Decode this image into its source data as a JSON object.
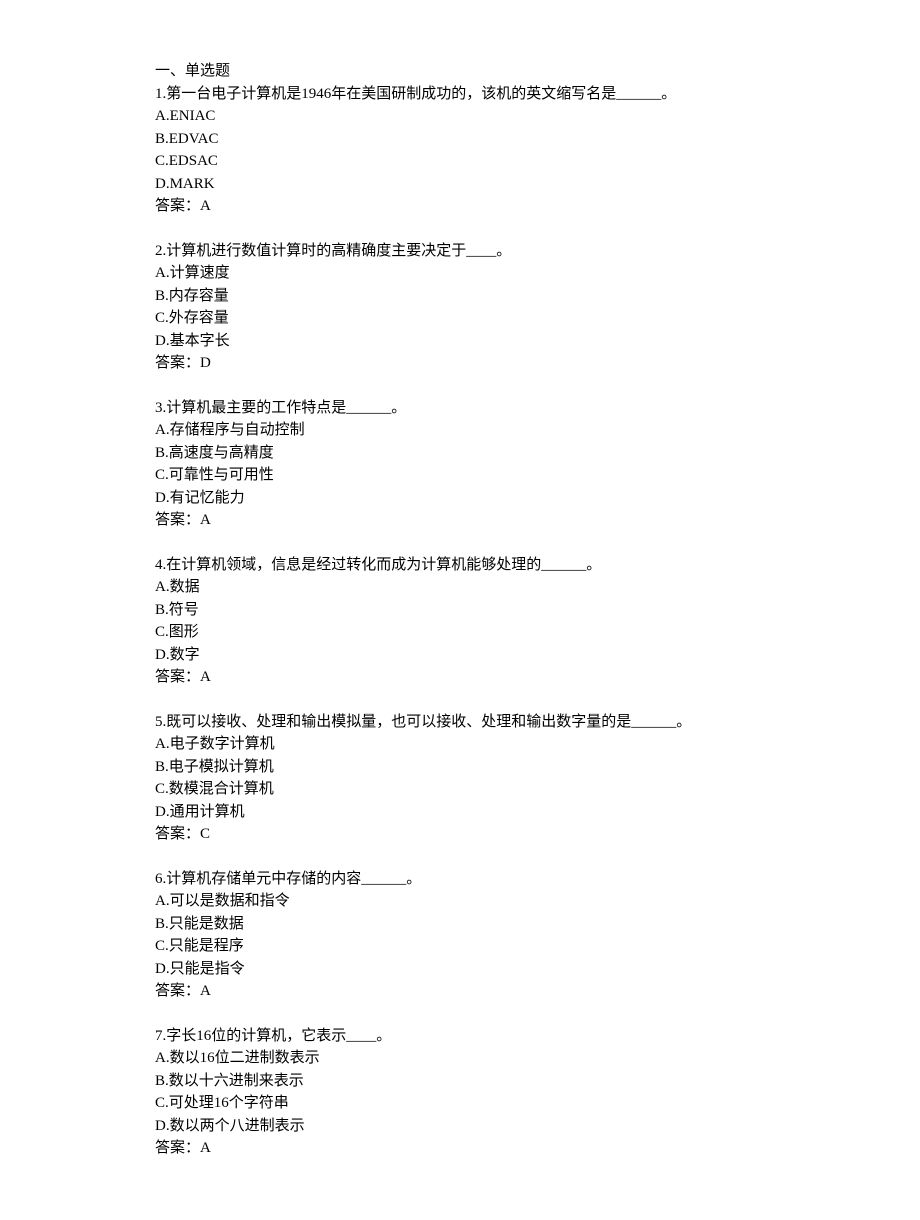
{
  "sectionTitle": "一、单选题",
  "answerLabel": "答案：",
  "questions": [
    {
      "number": "1",
      "stem": "第一台电子计算机是1946年在美国研制成功的，该机的英文缩写名是______。",
      "options": [
        "A.ENIAC",
        "B.EDVAC",
        "C.EDSAC",
        "D.MARK"
      ],
      "answer": "A"
    },
    {
      "number": "2",
      "stem": "计算机进行数值计算时的高精确度主要决定于____。",
      "options": [
        "A.计算速度",
        "B.内存容量",
        "C.外存容量",
        "D.基本字长"
      ],
      "answer": "D"
    },
    {
      "number": "3",
      "stem": "计算机最主要的工作特点是______。",
      "options": [
        "A.存储程序与自动控制",
        "B.高速度与高精度",
        "C.可靠性与可用性",
        "D.有记忆能力"
      ],
      "answer": "A"
    },
    {
      "number": "4",
      "stem": "在计算机领域，信息是经过转化而成为计算机能够处理的______。",
      "options": [
        "A.数据",
        "B.符号",
        "C.图形",
        "D.数字"
      ],
      "answer": "A"
    },
    {
      "number": "5",
      "stem": "既可以接收、处理和输出模拟量，也可以接收、处理和输出数字量的是______。",
      "options": [
        "A.电子数字计算机",
        "B.电子模拟计算机",
        "C.数模混合计算机",
        "D.通用计算机"
      ],
      "answer": "C"
    },
    {
      "number": "6",
      "stem": "计算机存储单元中存储的内容______。",
      "options": [
        "A.可以是数据和指令",
        "B.只能是数据",
        "C.只能是程序",
        "D.只能是指令"
      ],
      "answer": "A"
    },
    {
      "number": "7",
      "stem": "字长16位的计算机，它表示____。",
      "options": [
        "A.数以16位二进制数表示",
        "B.数以十六进制来表示",
        "C.可处理16个字符串",
        "D.数以两个八进制表示"
      ],
      "answer": "A"
    }
  ]
}
